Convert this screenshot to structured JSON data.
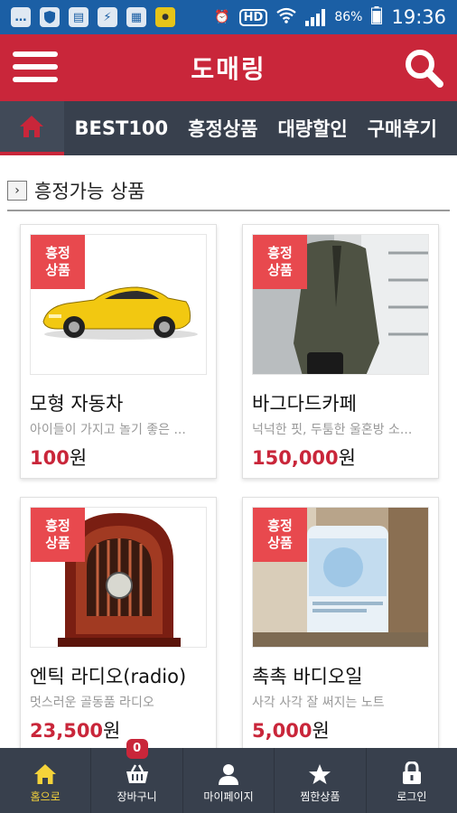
{
  "status_bar": {
    "battery": "86%",
    "time": "19:36",
    "hd_label": "HD",
    "icons": [
      "message-icon",
      "shield-icon",
      "note-icon",
      "flash-icon",
      "gallery-icon",
      "app-icon",
      "alarm-icon",
      "wifi-icon",
      "signal-icon"
    ]
  },
  "header": {
    "title": "도매링"
  },
  "nav": {
    "items": [
      {
        "label": "BEST100"
      },
      {
        "label": "흥정상품"
      },
      {
        "label": "대량할인"
      },
      {
        "label": "구매후기"
      }
    ]
  },
  "section": {
    "title": "흥정가능 상품"
  },
  "products": [
    {
      "badge": "흥정\n상품",
      "name": "모형 자동차",
      "desc": "아이들이 가지고 놀기 좋은 ...",
      "price": "100",
      "unit": "원",
      "image": "yellow-sports-car"
    },
    {
      "badge": "흥정\n상품",
      "name": "바그다드카페",
      "desc": "넉넉한 핏, 두툼한 울혼방 소...",
      "price": "150,000",
      "unit": "원",
      "image": "olive-coat"
    },
    {
      "badge": "흥정\n상품",
      "name": "엔틱 라디오(radio)",
      "desc": "멋스러운 골동품 라디오",
      "price": "23,500",
      "unit": "원",
      "image": "antique-radio"
    },
    {
      "badge": "흥정\n상품",
      "name": "촉촉 바디오일",
      "desc": "사각 사각 잘 써지는 노트",
      "price": "5,000",
      "unit": "원",
      "image": "body-oil-bottle"
    }
  ],
  "tabbar": {
    "items": [
      {
        "label": "홈으로",
        "icon": "home-icon",
        "active": true
      },
      {
        "label": "장바구니",
        "icon": "cart-icon",
        "badge": "0"
      },
      {
        "label": "마이페이지",
        "icon": "user-icon"
      },
      {
        "label": "찜한상품",
        "icon": "star-icon"
      },
      {
        "label": "로그인",
        "icon": "lock-icon"
      }
    ]
  },
  "colors": {
    "brand_red": "#c9263a",
    "nav_dark": "#38404d",
    "status_blue": "#1b5fa5",
    "badge_red": "#e8494e",
    "active_tab": "#f5d33a"
  }
}
